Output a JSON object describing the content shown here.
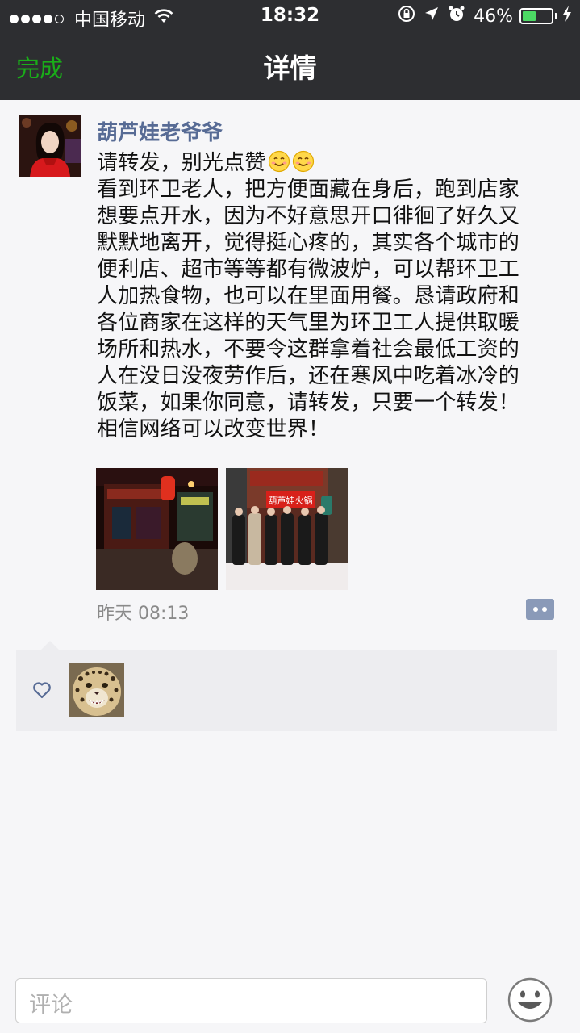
{
  "status_bar": {
    "carrier": "中国移动",
    "time": "18:32",
    "battery_percent": "46%",
    "battery_level": 0.46,
    "signal_strength": "4 of 5",
    "icons": [
      "wifi-icon",
      "rotation-lock-icon",
      "location-arrow-icon",
      "alarm-icon",
      "battery-icon",
      "charging-bolt-icon"
    ]
  },
  "nav": {
    "back_label": "完成",
    "title": "详情"
  },
  "post": {
    "author": "葫芦娃老爷爷",
    "first_line": "请转发，别光点赞",
    "body": "看到环卫老人，把方便面藏在身后，跑到店家\n想要点开水，因为不好意思开口徘徊了好久又\n默默地离开，觉得挺心疼的，其实各个城市的\n便利店、超市等等都有微波炉，可以帮环卫工\n人加热食物，也可以在里面用餐。恳请政府和\n各位商家在这样的天气里为环卫工人提供取暖\n场所和热水，不要令这群拿着社会最低工资的\n人在没日没夜劳作后，还在寒风中吃着冰冷的\n饭菜，如果你同意，请转发，只要一个转发！\n相信网络可以改变世界！",
    "emoji_count": 2,
    "photos": [
      "night-storefront-photo",
      "group-banner-photo"
    ],
    "photo_banner_text": "葫芦娃火锅",
    "timestamp": "昨天 08:13"
  },
  "likes": {
    "icon": "heart-outline-icon",
    "users": [
      "leopard-avatar"
    ]
  },
  "comment_bar": {
    "placeholder": "评论",
    "emoji_button_icon": "smiley-face-icon"
  },
  "colors": {
    "header_bg": "#2d2e31",
    "accent_green": "#1aad19",
    "author_blue": "#576b95",
    "battery_green": "#4cd964",
    "page_bg": "#f6f6f8",
    "likes_bg": "#ededf0"
  }
}
